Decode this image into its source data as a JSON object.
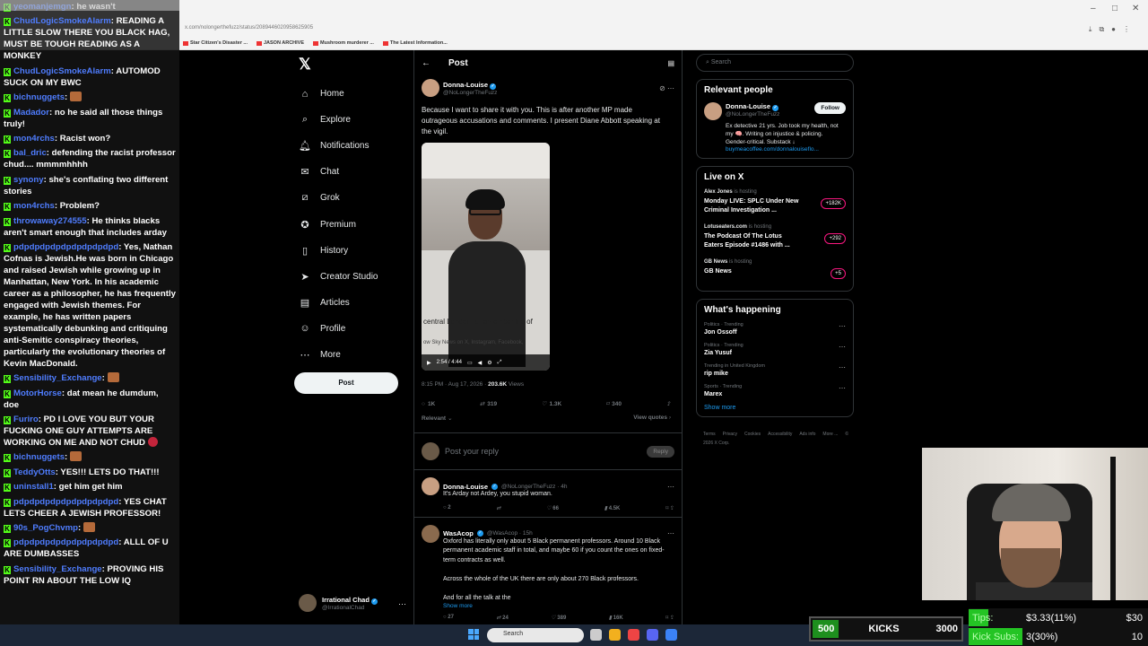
{
  "browser": {
    "url": "x.com/nolongerthefuzz/status/2089446020958625905",
    "bookmarks": [
      "Star Citizen's Disaster ...",
      "JASON ARCHIVE",
      "Mushroom murderer ...",
      "The Latest Information..."
    ],
    "window_controls": [
      "–",
      "□",
      "✕"
    ]
  },
  "chat": {
    "messages": [
      {
        "user": "yeomanjemgn",
        "text": "he wasn't",
        "color": "blue"
      },
      {
        "user": "ChudLogicSmokeAlarm",
        "text": "READING A LITTLE SLOW THERE YOU BLACK HAG, MUST BE TOUGH READING AS A MONKEY",
        "color": "blue"
      },
      {
        "user": "ChudLogicSmokeAlarm",
        "text": "AUTOMOD SUCK ON MY BWC",
        "color": "blue"
      },
      {
        "user": "bichnuggets",
        "text": "",
        "color": "blue",
        "emote": true
      },
      {
        "user": "Madador",
        "text": "no he said all those things truly!",
        "color": "blue"
      },
      {
        "user": "mon4rchs",
        "text": "Racist won?",
        "color": "blue"
      },
      {
        "user": "bal_dric",
        "text": "defending the racist professor chud.... mmmmhhhh",
        "color": "blue"
      },
      {
        "user": "synony",
        "text": "she's conflating two different stories",
        "color": "blue"
      },
      {
        "user": "mon4rchs",
        "text": "Problem?",
        "color": "blue"
      },
      {
        "user": "throwaway274555",
        "text": "He thinks blacks aren't smart enough that includes arday",
        "color": "blue"
      },
      {
        "user": "pdpdpdpdpdpdpdpdpdpd",
        "text": "Yes, Nathan Cofnas is Jewish.He was born in Chicago and raised Jewish while growing up in Manhattan, New York. In his academic career as a philosopher, he has frequently engaged with Jewish themes. For example, he has written papers systematically debunking and critiquing anti-Semitic conspiracy theories, particularly the evolutionary theories of Kevin MacDonald.",
        "color": "blue"
      },
      {
        "user": "Sensibility_Exchange",
        "text": "",
        "color": "blue",
        "emote": true
      },
      {
        "user": "MotorHorse",
        "text": "dat mean he dumdum, doe",
        "color": "blue"
      },
      {
        "user": "Furiro",
        "text": "PD I LOVE YOU BUT YOUR FUCKING ONE GUY ATTEMPTS ARE WORKING ON ME AND NOT CHUD",
        "color": "blue",
        "emote_red": true
      },
      {
        "user": "bichnuggets",
        "text": "",
        "color": "blue",
        "emote": true
      },
      {
        "user": "TeddyOtts",
        "text": "YES!!! LETS DO THAT!!!",
        "color": "blue"
      },
      {
        "user": "uninstall1",
        "text": "get him get him",
        "color": "blue"
      },
      {
        "user": "pdpdpdpdpdpdpdpdpdpd",
        "text": "YES CHAT LETS CHEER A JEWISH PROFESSOR!",
        "color": "blue"
      },
      {
        "user": "90s_PogChvmp",
        "text": "",
        "color": "blue",
        "emote": true
      },
      {
        "user": "pdpdpdpdpdpdpdpdpdpd",
        "text": "ALLL OF U ARE DUMBASSES",
        "color": "blue"
      },
      {
        "user": "Sensibility_Exchange",
        "text": "PROVING HIS POINT RN ABOUT THE LOW IQ",
        "color": "blue"
      }
    ]
  },
  "nav": {
    "items": [
      {
        "label": "Home",
        "icon": "⌂",
        "name": "home"
      },
      {
        "label": "Explore",
        "icon": "⌕",
        "name": "explore"
      },
      {
        "label": "Notifications",
        "icon": "🔔︎",
        "name": "notifications"
      },
      {
        "label": "Chat",
        "icon": "✉",
        "name": "chat"
      },
      {
        "label": "Grok",
        "icon": "⧄",
        "name": "grok"
      },
      {
        "label": "Premium",
        "icon": "✪",
        "name": "premium"
      },
      {
        "label": "History",
        "icon": "▯",
        "name": "history"
      },
      {
        "label": "Creator Studio",
        "icon": "➤",
        "name": "creator-studio"
      },
      {
        "label": "Articles",
        "icon": "▤",
        "name": "articles"
      },
      {
        "label": "Profile",
        "icon": "☺",
        "name": "profile"
      },
      {
        "label": "More",
        "icon": "⋯",
        "name": "more"
      }
    ],
    "post_label": "Post",
    "me": {
      "name": "Irrational Chad",
      "handle": "@IrrationalChad"
    }
  },
  "post": {
    "header": "Post",
    "author": {
      "name": "Donna-Louise",
      "handle": "@NoLongerTheFuzz"
    },
    "text": "Because I want to share it with you. This is after another MP made outrageous accusations and comments. I present Diane Abbott speaking at the vigil.",
    "video": {
      "caption": "central London to remember life of",
      "caption2": "ow Sky News on X, Instagram, Facebook,",
      "time": "2:54 / 4:44"
    },
    "timestamp": "8:15 PM · Aug 17, 2026 ·",
    "views": "203.6K",
    "views_label": "Views",
    "actions": {
      "replies": "1K",
      "reposts": "319",
      "likes": "1.3K",
      "bookmarks": "340"
    },
    "relevant": "Relevant",
    "view_quotes": "View quotes",
    "reply_placeholder": "Post your reply",
    "reply_button": "Reply"
  },
  "replies": [
    {
      "name": "Donna-Louise",
      "handle": "@NoLongerTheFuzz · 4h",
      "text": "It's Arday not Ardey, you stupid woman.",
      "replies": "2",
      "reposts": "",
      "likes": "66",
      "views": "4.5K"
    },
    {
      "name": "WasAcop",
      "handle": "@WasAcop · 15h",
      "text": "Oxford has literally only about 5 Black permanent professors. Around 10 Black permanent academic staff in total, and maybe 60 if you count the ones on fixed-term contracts as well.\n\nAcross the whole of the UK there are only about 270 Black professors.\n\nAnd for all the talk at the",
      "show_more": "Show more",
      "replies": "27",
      "reposts": "24",
      "likes": "389",
      "views": "16K"
    }
  ],
  "sidebar": {
    "search_placeholder": "Search",
    "relevant_title": "Relevant people",
    "relevant_person": {
      "name": "Donna-Louise",
      "handle": "@NoLongerTheFuzz",
      "follow": "Follow",
      "bio": "Ex detective 21 yrs. Job took my health, not my 🧠. Writing on injustice & policing. Gender-critical. Substack ↓",
      "link": "buymeacoffee.com/donnalouiseflo..."
    },
    "live_title": "Live on X",
    "live": [
      {
        "host": "Alex Jones",
        "status": "is hosting",
        "title": "Monday LIVE: SPLC Under New Criminal Investigation ...",
        "badge": "+182K"
      },
      {
        "host": "Lotuseaters.com",
        "status": "is hosting",
        "title": "The Podcast Of The Lotus Eaters Episode #1486 with ...",
        "badge": "+292"
      },
      {
        "host": "GB News",
        "status": "is hosting",
        "title": "GB News",
        "badge": "+5"
      }
    ],
    "happening_title": "What's happening",
    "trends": [
      {
        "category": "Politics · Trending",
        "name": "Jon Ossoff"
      },
      {
        "category": "Politics · Trending",
        "name": "Zia Yusuf"
      },
      {
        "category": "Trending in United Kingdom",
        "name": "rip mike"
      },
      {
        "category": "Sports · Trending",
        "name": "Marex"
      }
    ],
    "show_more": "Show more",
    "footer": [
      "Terms",
      "Privacy",
      "Cookies",
      "Accessibility",
      "Ads info",
      "More ...",
      "© 2026 X Corp."
    ]
  },
  "taskbar": {
    "search": "Search"
  },
  "stream": {
    "kicks": {
      "min": "500",
      "label": "KICKS",
      "max": "3000",
      "progress": 0.17
    },
    "tips": {
      "label": "Tips:",
      "value": "$3.33(11%)",
      "goal": "$30",
      "progress": 0.11
    },
    "subs": {
      "label": "Kick Subs:",
      "value": "3(30%)",
      "goal": "10",
      "progress": 0.3
    }
  },
  "colors": {
    "accent": "#1d9bf0",
    "kick_green": "#53fc18",
    "live_pink": "#f91880",
    "background": "#000000"
  }
}
